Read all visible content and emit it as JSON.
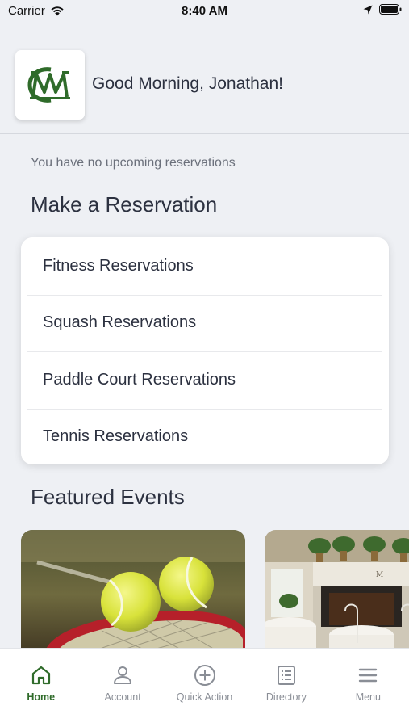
{
  "status": {
    "carrier": "Carrier",
    "time": "8:40 AM"
  },
  "header": {
    "greeting": "Good Morning, Jonathan!"
  },
  "reservations": {
    "empty_text": "You have no upcoming reservations",
    "section_title": "Make a Reservation",
    "items": [
      {
        "label": "Fitness Reservations"
      },
      {
        "label": "Squash Reservations"
      },
      {
        "label": "Paddle Court Reservations"
      },
      {
        "label": "Tennis Reservations"
      }
    ]
  },
  "events": {
    "section_title": "Featured Events"
  },
  "tabs": [
    {
      "label": "Home",
      "icon": "home-icon"
    },
    {
      "label": "Account",
      "icon": "person-icon"
    },
    {
      "label": "Quick Action",
      "icon": "plus-circle-icon"
    },
    {
      "label": "Directory",
      "icon": "list-icon"
    },
    {
      "label": "Menu",
      "icon": "hamburger-icon"
    }
  ],
  "colors": {
    "accent": "#2f6b2a",
    "background": "#eef0f4"
  }
}
